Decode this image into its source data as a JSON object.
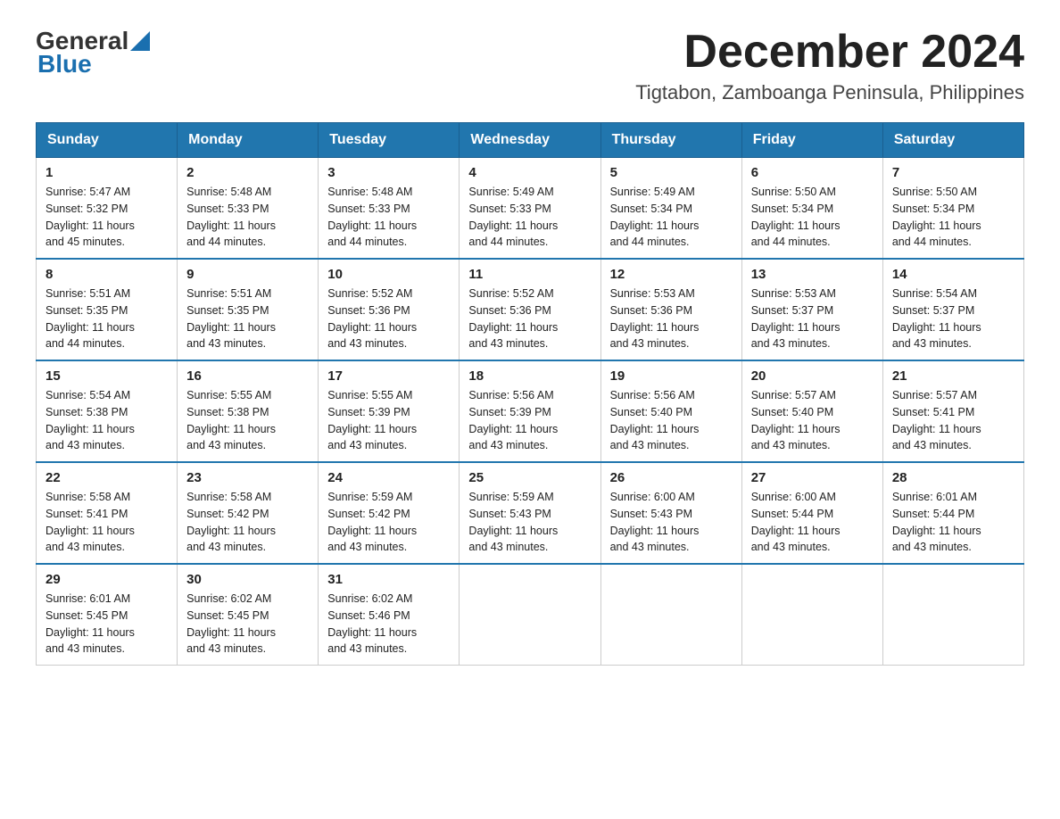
{
  "logo": {
    "general": "General",
    "blue": "Blue",
    "line2": "Blue"
  },
  "header": {
    "month": "December 2024",
    "location": "Tigtabon, Zamboanga Peninsula, Philippines"
  },
  "days_of_week": [
    "Sunday",
    "Monday",
    "Tuesday",
    "Wednesday",
    "Thursday",
    "Friday",
    "Saturday"
  ],
  "weeks": [
    [
      {
        "day": "1",
        "sunrise": "5:47 AM",
        "sunset": "5:32 PM",
        "daylight": "11 hours and 45 minutes."
      },
      {
        "day": "2",
        "sunrise": "5:48 AM",
        "sunset": "5:33 PM",
        "daylight": "11 hours and 44 minutes."
      },
      {
        "day": "3",
        "sunrise": "5:48 AM",
        "sunset": "5:33 PM",
        "daylight": "11 hours and 44 minutes."
      },
      {
        "day": "4",
        "sunrise": "5:49 AM",
        "sunset": "5:33 PM",
        "daylight": "11 hours and 44 minutes."
      },
      {
        "day": "5",
        "sunrise": "5:49 AM",
        "sunset": "5:34 PM",
        "daylight": "11 hours and 44 minutes."
      },
      {
        "day": "6",
        "sunrise": "5:50 AM",
        "sunset": "5:34 PM",
        "daylight": "11 hours and 44 minutes."
      },
      {
        "day": "7",
        "sunrise": "5:50 AM",
        "sunset": "5:34 PM",
        "daylight": "11 hours and 44 minutes."
      }
    ],
    [
      {
        "day": "8",
        "sunrise": "5:51 AM",
        "sunset": "5:35 PM",
        "daylight": "11 hours and 44 minutes."
      },
      {
        "day": "9",
        "sunrise": "5:51 AM",
        "sunset": "5:35 PM",
        "daylight": "11 hours and 43 minutes."
      },
      {
        "day": "10",
        "sunrise": "5:52 AM",
        "sunset": "5:36 PM",
        "daylight": "11 hours and 43 minutes."
      },
      {
        "day": "11",
        "sunrise": "5:52 AM",
        "sunset": "5:36 PM",
        "daylight": "11 hours and 43 minutes."
      },
      {
        "day": "12",
        "sunrise": "5:53 AM",
        "sunset": "5:36 PM",
        "daylight": "11 hours and 43 minutes."
      },
      {
        "day": "13",
        "sunrise": "5:53 AM",
        "sunset": "5:37 PM",
        "daylight": "11 hours and 43 minutes."
      },
      {
        "day": "14",
        "sunrise": "5:54 AM",
        "sunset": "5:37 PM",
        "daylight": "11 hours and 43 minutes."
      }
    ],
    [
      {
        "day": "15",
        "sunrise": "5:54 AM",
        "sunset": "5:38 PM",
        "daylight": "11 hours and 43 minutes."
      },
      {
        "day": "16",
        "sunrise": "5:55 AM",
        "sunset": "5:38 PM",
        "daylight": "11 hours and 43 minutes."
      },
      {
        "day": "17",
        "sunrise": "5:55 AM",
        "sunset": "5:39 PM",
        "daylight": "11 hours and 43 minutes."
      },
      {
        "day": "18",
        "sunrise": "5:56 AM",
        "sunset": "5:39 PM",
        "daylight": "11 hours and 43 minutes."
      },
      {
        "day": "19",
        "sunrise": "5:56 AM",
        "sunset": "5:40 PM",
        "daylight": "11 hours and 43 minutes."
      },
      {
        "day": "20",
        "sunrise": "5:57 AM",
        "sunset": "5:40 PM",
        "daylight": "11 hours and 43 minutes."
      },
      {
        "day": "21",
        "sunrise": "5:57 AM",
        "sunset": "5:41 PM",
        "daylight": "11 hours and 43 minutes."
      }
    ],
    [
      {
        "day": "22",
        "sunrise": "5:58 AM",
        "sunset": "5:41 PM",
        "daylight": "11 hours and 43 minutes."
      },
      {
        "day": "23",
        "sunrise": "5:58 AM",
        "sunset": "5:42 PM",
        "daylight": "11 hours and 43 minutes."
      },
      {
        "day": "24",
        "sunrise": "5:59 AM",
        "sunset": "5:42 PM",
        "daylight": "11 hours and 43 minutes."
      },
      {
        "day": "25",
        "sunrise": "5:59 AM",
        "sunset": "5:43 PM",
        "daylight": "11 hours and 43 minutes."
      },
      {
        "day": "26",
        "sunrise": "6:00 AM",
        "sunset": "5:43 PM",
        "daylight": "11 hours and 43 minutes."
      },
      {
        "day": "27",
        "sunrise": "6:00 AM",
        "sunset": "5:44 PM",
        "daylight": "11 hours and 43 minutes."
      },
      {
        "day": "28",
        "sunrise": "6:01 AM",
        "sunset": "5:44 PM",
        "daylight": "11 hours and 43 minutes."
      }
    ],
    [
      {
        "day": "29",
        "sunrise": "6:01 AM",
        "sunset": "5:45 PM",
        "daylight": "11 hours and 43 minutes."
      },
      {
        "day": "30",
        "sunrise": "6:02 AM",
        "sunset": "5:45 PM",
        "daylight": "11 hours and 43 minutes."
      },
      {
        "day": "31",
        "sunrise": "6:02 AM",
        "sunset": "5:46 PM",
        "daylight": "11 hours and 43 minutes."
      },
      null,
      null,
      null,
      null
    ]
  ],
  "labels": {
    "sunrise": "Sunrise:",
    "sunset": "Sunset:",
    "daylight": "Daylight:"
  }
}
